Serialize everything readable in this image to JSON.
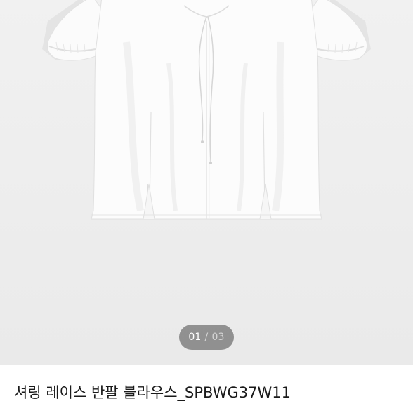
{
  "gallery": {
    "current_page": "01",
    "separator": "/",
    "total_pages": "03",
    "image_subject": "white-short-sleeve-blouse-icon"
  },
  "product": {
    "title": "셔링 레이스 반팔 블라우스_SPBWG37W11"
  },
  "colors": {
    "image_background": "#eeeeee",
    "indicator_background": "#6e6e6e",
    "title_text": "#1a1a1a"
  }
}
